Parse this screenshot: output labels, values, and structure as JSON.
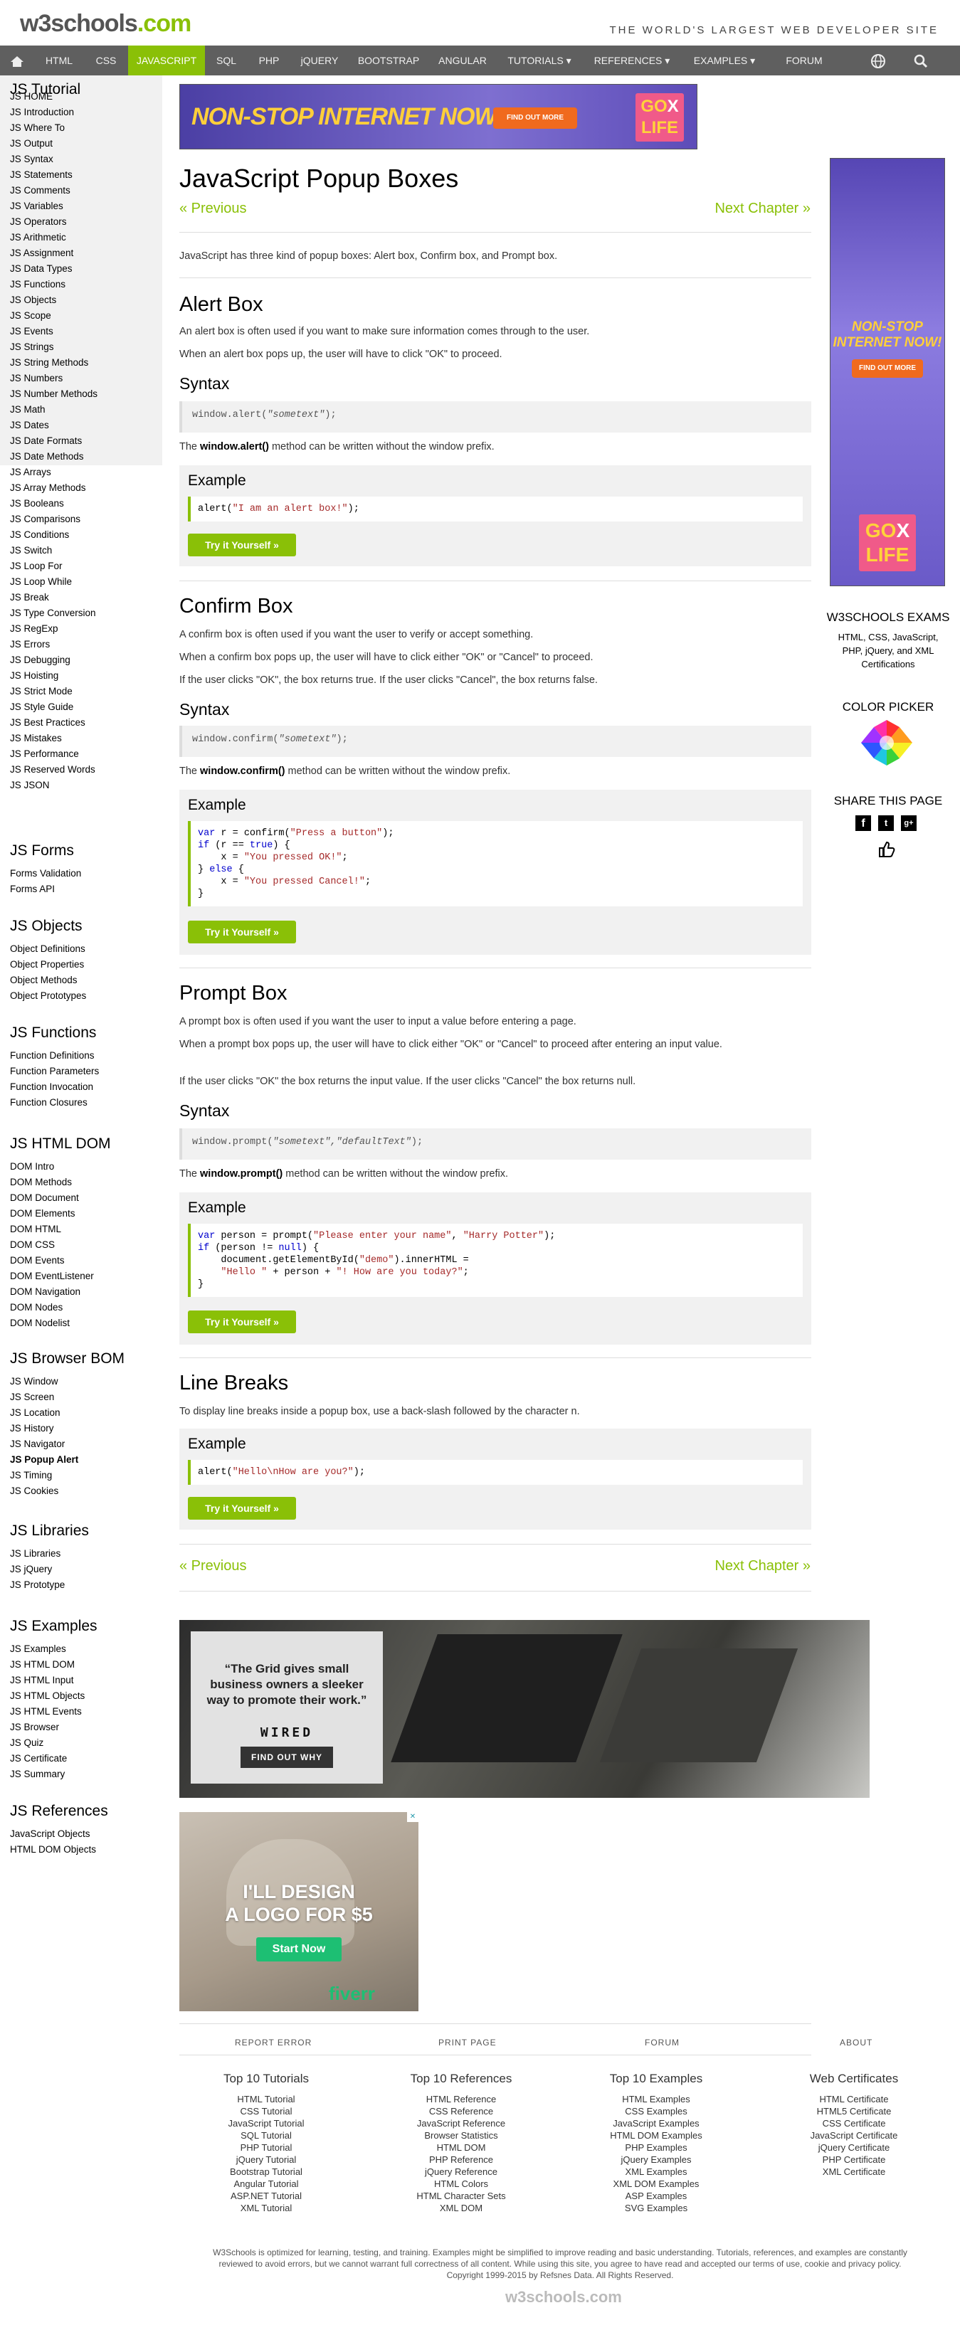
{
  "header": {
    "logo_main": "w3schools",
    "logo_tld": ".com",
    "tagline": "THE WORLD'S LARGEST WEB DEVELOPER SITE"
  },
  "nav": {
    "items": [
      "HTML",
      "CSS",
      "JAVASCRIPT",
      "SQL",
      "PHP",
      "jQUERY",
      "BOOTSTRAP",
      "ANGULAR",
      "TUTORIALS ▾",
      "REFERENCES ▾",
      "EXAMPLES ▾",
      "FORUM"
    ],
    "active": "JAVASCRIPT"
  },
  "sidebar": {
    "tutorial_title": "JS Tutorial",
    "tutorial": [
      "JS HOME",
      "JS Introduction",
      "JS Where To",
      "JS Output",
      "JS Syntax",
      "JS Statements",
      "JS Comments",
      "JS Variables",
      "JS Operators",
      "JS Arithmetic",
      "JS Assignment",
      "JS Data Types",
      "JS Functions",
      "JS Objects",
      "JS Scope",
      "JS Events",
      "JS Strings",
      "JS String Methods",
      "JS Numbers",
      "JS Number Methods",
      "JS Math",
      "JS Dates",
      "JS Date Formats",
      "JS Date Methods",
      "JS Arrays",
      "JS Array Methods",
      "JS Booleans",
      "JS Comparisons",
      "JS Conditions",
      "JS Switch",
      "JS Loop For",
      "JS Loop While",
      "JS Break",
      "JS Type Conversion",
      "JS RegExp",
      "JS Errors",
      "JS Debugging",
      "JS Hoisting",
      "JS Strict Mode",
      "JS Style Guide",
      "JS Best Practices",
      "JS Mistakes",
      "JS Performance",
      "JS Reserved Words",
      "JS JSON"
    ],
    "forms_title": "JS Forms",
    "forms": [
      "Forms Validation",
      "Forms API"
    ],
    "objects_title": "JS Objects",
    "objects": [
      "Object Definitions",
      "Object Properties",
      "Object Methods",
      "Object Prototypes"
    ],
    "functions_title": "JS Functions",
    "functions": [
      "Function Definitions",
      "Function Parameters",
      "Function Invocation",
      "Function Closures"
    ],
    "dom_title": "JS HTML DOM",
    "dom": [
      "DOM Intro",
      "DOM Methods",
      "DOM Document",
      "DOM Elements",
      "DOM HTML",
      "DOM CSS",
      "DOM Events",
      "DOM EventListener",
      "DOM Navigation",
      "DOM Nodes",
      "DOM Nodelist"
    ],
    "bom_title": "JS Browser BOM",
    "bom": [
      "JS Window",
      "JS Screen",
      "JS Location",
      "JS History",
      "JS Navigator",
      "JS Popup Alert",
      "JS Timing",
      "JS Cookies"
    ],
    "libs_title": "JS Libraries",
    "libs": [
      "JS Libraries",
      "JS jQuery",
      "JS Prototype"
    ],
    "examples_title": "JS Examples",
    "examples": [
      "JS Examples",
      "JS HTML DOM",
      "JS HTML Input",
      "JS HTML Objects",
      "JS HTML Events",
      "JS Browser",
      "JS Quiz",
      "JS Certificate",
      "JS Summary"
    ],
    "refs_title": "JS References",
    "refs": [
      "JavaScript Objects",
      "HTML DOM Objects"
    ],
    "active": "JS Popup Alert"
  },
  "ads": {
    "top_text": "NON-STOP INTERNET NOW!",
    "top_btn": "FIND OUT MORE",
    "gox_top": "GO",
    "gox_bottom": "LIFE",
    "gox_x": "X",
    "right_text": "NON-STOP INTERNET NOW!",
    "right_btn": "FIND OUT MORE",
    "wired_quote": "“The Grid gives small business owners a sleeker way to promote their work.”",
    "wired_logo": "WIRED",
    "wired_btn": "FIND OUT WHY",
    "fiverr_l1": "I'LL DESIGN",
    "fiverr_l2": "A LOGO FOR $5",
    "fiverr_btn": "Start Now",
    "fiverr_brand": "fiverr"
  },
  "main": {
    "title": "JavaScript Popup Boxes",
    "prev": "« Previous",
    "next": "Next Chapter »",
    "intro": "JavaScript has three kind of popup boxes: Alert box, Confirm box, and Prompt box.",
    "alert": {
      "h": "Alert Box",
      "p1": "An alert box is often used if you want to make sure information comes through to the user.",
      "p2": "When an alert box pops up, the user will have to click \"OK\" to proceed.",
      "syntax_h": "Syntax",
      "syntax_fn": "window.alert(",
      "syntax_arg": "\"sometext\"",
      "syntax_end": ");",
      "note_pre": "The ",
      "note_b": "window.alert()",
      "note_post": " method can be written without the window prefix.",
      "ex_h": "Example",
      "try": "Try it Yourself »"
    },
    "confirm": {
      "h": "Confirm Box",
      "p1": "A confirm box is often used if you want the user to verify or accept something.",
      "p2": "When a confirm box pops up, the user will have to click either \"OK\" or \"Cancel\" to proceed.",
      "p3": "If the user clicks \"OK\", the box returns true. If the user clicks \"Cancel\", the box returns false.",
      "syntax_h": "Syntax",
      "syntax_fn": "window.confirm(",
      "syntax_arg": "\"sometext\"",
      "syntax_end": ");",
      "note_pre": "The ",
      "note_b": "window.confirm()",
      "note_post": " method can be written without the window prefix.",
      "ex_h": "Example",
      "try": "Try it Yourself »"
    },
    "prompt": {
      "h": "Prompt Box",
      "p1": "A prompt box is often used if you want the user to input a value before entering a page.",
      "p2": "When a prompt box pops up, the user will have to click either \"OK\" or \"Cancel\" to proceed after entering an input value.",
      "p3": "If the user clicks \"OK\" the box returns the input value. If the user clicks \"Cancel\" the box returns null.",
      "syntax_h": "Syntax",
      "syntax_fn": "window.prompt(",
      "syntax_arg": "\"sometext\",\"defaultText\"",
      "syntax_end": ");",
      "note_pre": "The ",
      "note_b": "window.prompt()",
      "note_post": " method can be written without the window prefix.",
      "ex_h": "Example",
      "try": "Try it Yourself »"
    },
    "linebreaks": {
      "h": "Line Breaks",
      "p1": "To display line breaks inside a popup box, use a back-slash followed by the character n.",
      "ex_h": "Example",
      "try": "Try it Yourself »"
    }
  },
  "right": {
    "exams_h": "W3SCHOOLS EXAMS",
    "exams_p": "HTML, CSS, JavaScript, PHP, jQuery, and XML Certifications",
    "picker_h": "COLOR PICKER",
    "share_h": "SHARE THIS PAGE"
  },
  "footer": {
    "links": [
      "REPORT ERROR",
      "PRINT PAGE",
      "FORUM",
      "ABOUT"
    ],
    "cols": [
      {
        "h": "Top 10 Tutorials",
        "items": [
          "HTML Tutorial",
          "CSS Tutorial",
          "JavaScript Tutorial",
          "SQL Tutorial",
          "PHP Tutorial",
          "jQuery Tutorial",
          "Bootstrap Tutorial",
          "Angular Tutorial",
          "ASP.NET Tutorial",
          "XML Tutorial"
        ]
      },
      {
        "h": "Top 10 References",
        "items": [
          "HTML Reference",
          "CSS Reference",
          "JavaScript Reference",
          "Browser Statistics",
          "HTML DOM",
          "PHP Reference",
          "jQuery Reference",
          "HTML Colors",
          "HTML Character Sets",
          "XML DOM"
        ]
      },
      {
        "h": "Top 10 Examples",
        "items": [
          "HTML Examples",
          "CSS Examples",
          "JavaScript Examples",
          "HTML DOM Examples",
          "PHP Examples",
          "jQuery Examples",
          "XML Examples",
          "XML DOM Examples",
          "ASP Examples",
          "SVG Examples"
        ]
      },
      {
        "h": "Web Certificates",
        "items": [
          "HTML Certificate",
          "HTML5 Certificate",
          "CSS Certificate",
          "JavaScript Certificate",
          "jQuery Certificate",
          "PHP Certificate",
          "XML Certificate"
        ]
      }
    ],
    "fine1": "W3Schools is optimized for learning, testing, and training. Examples might be simplified to improve reading and basic understanding. Tutorials, references, and examples are constantly",
    "fine2": "reviewed to avoid errors, but we cannot warrant full correctness of all content. While using this site, you agree to have read and accepted our terms of use, cookie and privacy policy.",
    "fine3": "Copyright 1999-2015 by Refsnes Data. All Rights Reserved.",
    "logo": "w3schools.com"
  },
  "colors": {
    "accent": "#8ac007",
    "nav_bg": "#5f5f5f",
    "sidebar_bg": "#f1f1f1",
    "example_bg": "#f1f1f1"
  }
}
